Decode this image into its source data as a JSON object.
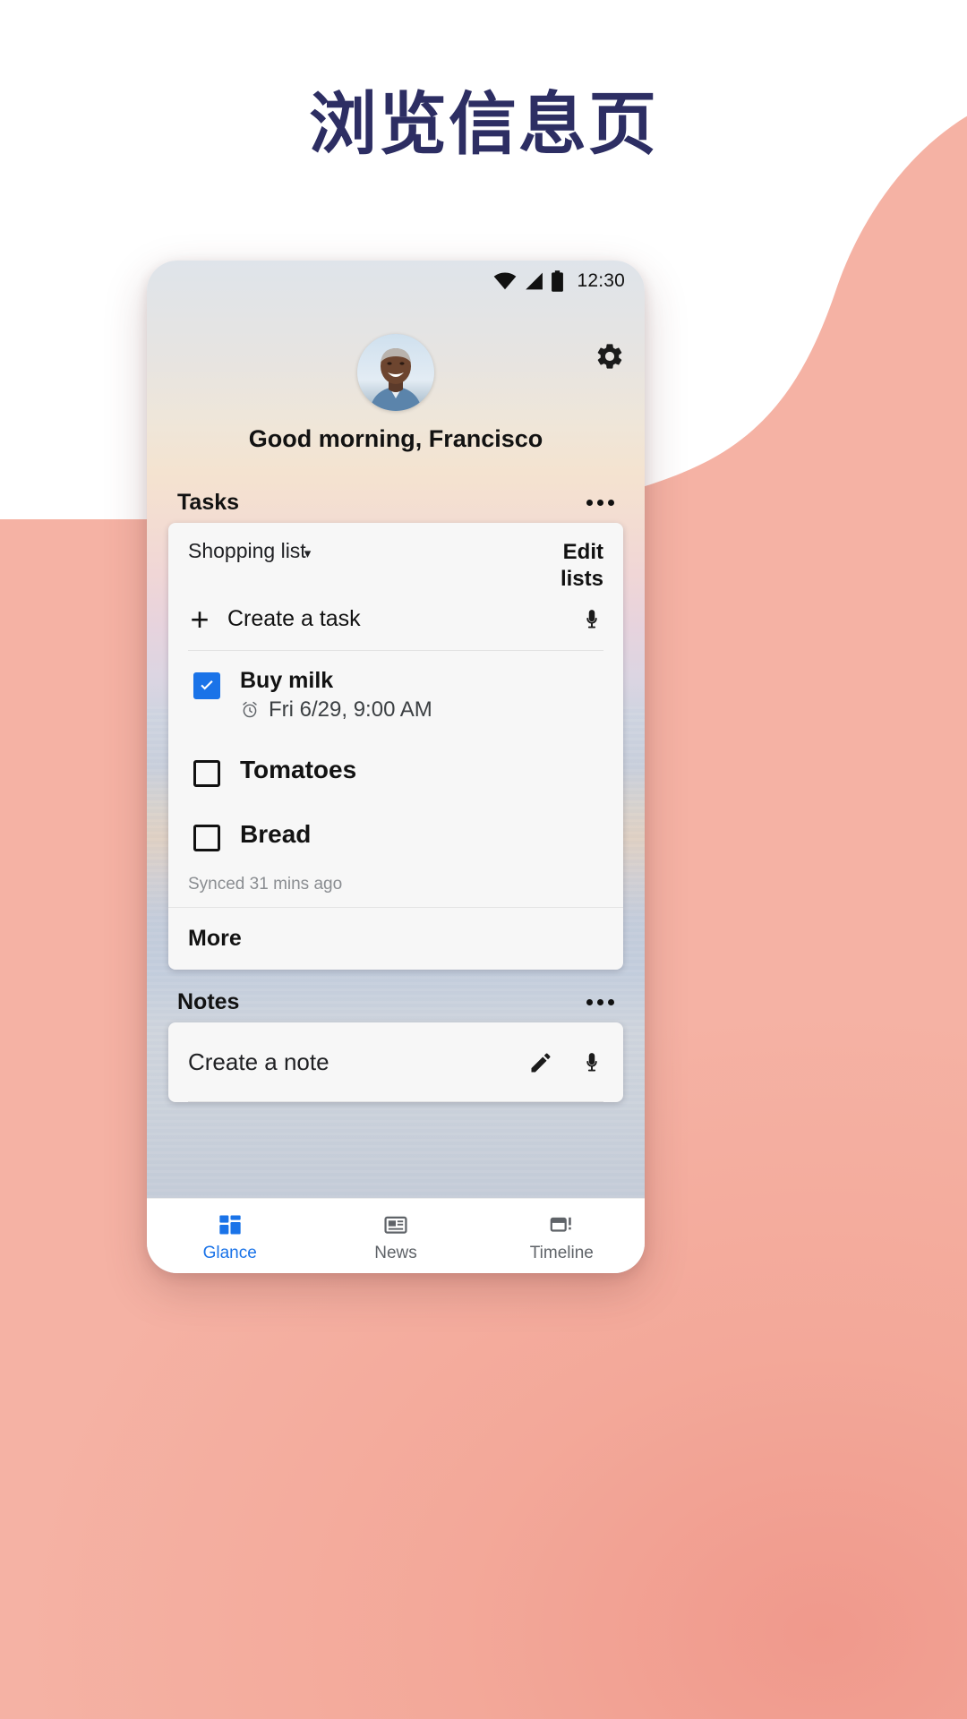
{
  "page": {
    "headline": "浏览信息页",
    "headline_color": "#2d2e63",
    "background_color": "#f3a899"
  },
  "phone": {
    "status_bar": {
      "time": "12:30",
      "icons": [
        "wifi-icon",
        "cell-signal-icon",
        "battery-icon"
      ]
    },
    "header": {
      "settings_icon": "gear-icon",
      "avatar": "user-avatar",
      "greeting": "Good morning, Francisco"
    },
    "tasks_section": {
      "title": "Tasks",
      "overflow_icon": "more-options-icon",
      "card": {
        "list_name": "Shopping list",
        "list_caret": "▾",
        "edit_lists_label": "Edit lists",
        "create_task_label": "Create a task",
        "create_task_plus": "+",
        "mic_icon": "microphone-icon",
        "items": [
          {
            "title": "Buy milk",
            "checked": true,
            "reminder": "Fri 6/29, 9:00 AM",
            "reminder_icon": "alarm-icon"
          },
          {
            "title": "Tomatoes",
            "checked": false,
            "reminder": "",
            "reminder_icon": ""
          },
          {
            "title": "Bread",
            "checked": false,
            "reminder": "",
            "reminder_icon": ""
          }
        ],
        "synced_text": "Synced 31 mins ago",
        "more_label": "More"
      }
    },
    "notes_section": {
      "title": "Notes",
      "overflow_icon": "more-options-icon",
      "card": {
        "placeholder": "Create a note",
        "pencil_icon": "pencil-icon",
        "mic_icon": "microphone-icon"
      }
    },
    "bottom_nav": {
      "active_color": "#1a73e8",
      "items": [
        {
          "label": "Glance",
          "icon": "glance-icon",
          "active": true
        },
        {
          "label": "News",
          "icon": "news-icon",
          "active": false
        },
        {
          "label": "Timeline",
          "icon": "timeline-icon",
          "active": false
        }
      ]
    }
  }
}
